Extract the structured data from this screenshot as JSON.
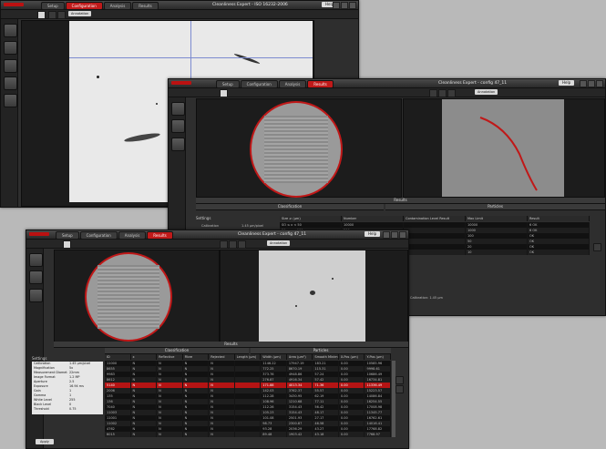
{
  "app": {
    "brand_color": "#c01a1a"
  },
  "win1": {
    "tabs": [
      "Setup",
      "Configuration",
      "Analysis",
      "Results"
    ],
    "active_tab": "Configuration",
    "title": "Cleanliness Expert - ISO 16232-2006",
    "help": "Help",
    "annotation": "Annotation"
  },
  "win2": {
    "tabs": [
      "Setup",
      "Configuration",
      "Analysis",
      "Results"
    ],
    "active_tab": "Results",
    "title": "Cleanliness Expert - config 47_11",
    "help": "Help",
    "annotation": "Annotation",
    "results_label": "Results",
    "classification_label": "Classification",
    "particles_label": "Particles",
    "settings_label": "Settings",
    "calibration_label": "Calibration",
    "calibration_value": "1.45 µm/pixel",
    "size_header": [
      "Size ≥ (µm)",
      "Number",
      "Contamination Level Result",
      "Max Limit",
      "Result"
    ],
    "size_rows": [
      [
        "SO ≤ x < 50",
        "10000",
        "",
        "10000",
        "6 OK"
      ],
      [
        "50 ≤ x < 100",
        "200",
        "",
        "1000",
        "6 OK"
      ],
      [
        "100 ≤ x < 150",
        "3",
        "",
        "100",
        "OK"
      ],
      [
        "",
        "1",
        "",
        "50",
        "OK"
      ],
      [
        "",
        "1",
        "",
        "20",
        "OK"
      ],
      [
        "",
        "0",
        "",
        "10",
        "OK"
      ]
    ],
    "status_text": "Calibration: 1.45 µm"
  },
  "win3": {
    "tabs": [
      "Setup",
      "Configuration",
      "Analysis",
      "Results"
    ],
    "active_tab": "Results",
    "title": "Cleanliness Expert - config 47_11",
    "help": "Help",
    "annotation": "Annotation",
    "results_label": "Results",
    "classification_label": "Classification",
    "particles_label": "Particles",
    "settings_label": "Settings",
    "apply": "Apply",
    "settings": [
      [
        "Calibration",
        "1.45 µm/pixel"
      ],
      [
        "Magnification",
        "5x"
      ],
      [
        "Measurement Diameter",
        "22mm"
      ],
      [
        "Image Format",
        "1.2 MP"
      ],
      [
        "Aperture",
        "2.5"
      ],
      [
        "Exposure",
        "16.94 ms"
      ],
      [
        "Gain",
        "1"
      ],
      [
        "Gamma",
        "1"
      ],
      [
        "White Level",
        "255"
      ],
      [
        "Black Level",
        "0"
      ],
      [
        "Threshold",
        "0.75"
      ]
    ],
    "table_header": [
      "ID",
      "x",
      "Reflective",
      "Fibre",
      "Rejected",
      "Length (µm)",
      "Width (µm)",
      "Area (µm²)",
      "Smooth Minimum Inner Circle (µm)",
      "X-Pos (µm)",
      "Y-Pos (µm)"
    ],
    "table_rows": [
      [
        "11000",
        "N",
        "N",
        "N",
        "N",
        "",
        "1146.22",
        "17947.19",
        "183.21",
        "0.00",
        "10585.96"
      ],
      [
        "8655",
        "N",
        "N",
        "N",
        "N",
        "",
        "772.25",
        "8670.19",
        "115.31",
        "0.00",
        "9998.61"
      ],
      [
        "9983",
        "N",
        "N",
        "N",
        "N",
        "",
        "373.76",
        "4948.86",
        "57.24",
        "0.00",
        "10686.49"
      ],
      [
        "8612",
        "N",
        "N",
        "N",
        "N",
        "",
        "276.87",
        "4916.34",
        "57.42",
        "0.00",
        "16734.81"
      ],
      [
        "5140",
        "N",
        "N",
        "N",
        "N",
        "",
        "171.88",
        "4013.34",
        "71.36",
        "0.00",
        "11336.49"
      ],
      [
        "2006",
        "N",
        "N",
        "N",
        "N",
        "",
        "142.03",
        "3762.37",
        "55.57",
        "0.00",
        "15223.57"
      ],
      [
        "135",
        "N",
        "N",
        "N",
        "N",
        "",
        "112.28",
        "3430.95",
        "62.19",
        "0.00",
        "14086.84"
      ],
      [
        "136",
        "N",
        "N",
        "N",
        "N",
        "",
        "108.96",
        "1210.68",
        "77.11",
        "0.00",
        "16254.55"
      ],
      [
        "7040",
        "N",
        "N",
        "N",
        "N",
        "",
        "112.26",
        "3154.43",
        "56.42",
        "0.00",
        "17008.98"
      ],
      [
        "11003",
        "N",
        "N",
        "N",
        "N",
        "",
        "105.23",
        "3154.43",
        "48.17",
        "0.00",
        "11345.77"
      ],
      [
        "11001",
        "N",
        "N",
        "N",
        "N",
        "",
        "101.08",
        "2501.93",
        "27.17",
        "0.00",
        "16762.61"
      ],
      [
        "11002",
        "N",
        "N",
        "N",
        "N",
        "",
        "98.73",
        "2300.87",
        "46.58",
        "0.00",
        "14016.41"
      ],
      [
        "4762",
        "N",
        "N",
        "N",
        "N",
        "",
        "93.28",
        "2036.29",
        "43.27",
        "0.00",
        "17768.82"
      ],
      [
        "6015",
        "N",
        "N",
        "N",
        "N",
        "",
        "89.48",
        "1903.42",
        "43.18",
        "0.00",
        "7768.97"
      ]
    ],
    "selected_row": 4
  }
}
